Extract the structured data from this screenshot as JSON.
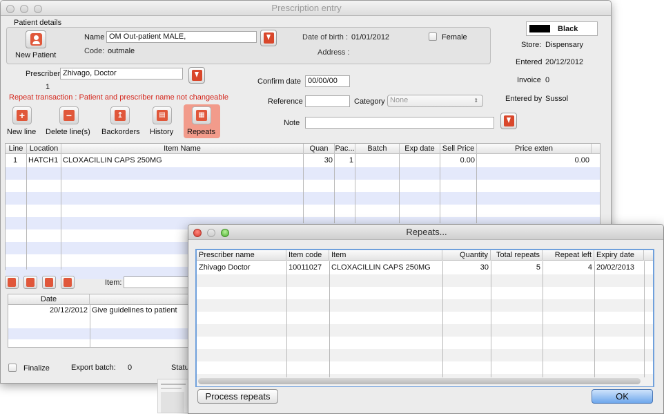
{
  "main_window": {
    "title": "Prescription entry",
    "patient_details": {
      "section_title": "Patient details",
      "new_patient_label": "New Patient",
      "name_label": "Name",
      "name_value": "OM Out-patient MALE,",
      "code_label": "Code:",
      "code_value": "outmale",
      "dob_label": "Date of birth :",
      "dob_value": "01/01/2012",
      "address_label": "Address :",
      "female_label": "Female"
    },
    "status_panel": {
      "color_label": "Black",
      "store_label": "Store:",
      "store_value": "Dispensary",
      "entered_label": "Entered",
      "entered_value": "20/12/2012",
      "invoice_label": "Invoice",
      "invoice_value": "0",
      "entered_by_label": "Entered by",
      "entered_by_value": "Sussol"
    },
    "prescriber_label": "Prescriber",
    "prescriber_value": "Zhivago, Doctor",
    "prescriber_count": "1",
    "warning_text": "Repeat transaction : Patient and prescriber  name not changeable",
    "confirm_date_label": "Confirm date",
    "confirm_date_value": "00/00/00",
    "reference_label": "Reference",
    "reference_value": "",
    "category_label": "Category",
    "category_value": "None",
    "note_label": "Note",
    "note_value": "",
    "toolbar": {
      "new_line": "New line",
      "delete_lines": "Delete line(s)",
      "backorders": "Backorders",
      "history": "History",
      "repeats": "Repeats"
    },
    "lines_table": {
      "headers": [
        "Line",
        "Location",
        "Item Name",
        "Quan",
        "Pac...",
        "Batch",
        "Exp date",
        "Sell Price",
        "Price exten"
      ],
      "rows": [
        {
          "line": "1",
          "location": "HATCH1",
          "item": "CLOXACILLIN CAPS 250MG",
          "quan": "30",
          "pack": "1",
          "batch": "",
          "exp": "",
          "sell": "0.00",
          "exten": "0.00"
        }
      ]
    },
    "item_label": "Item:",
    "history_table": {
      "header_date": "Date",
      "rows": [
        {
          "date": "20/12/2012",
          "text": "Give guidelines to patient"
        }
      ]
    },
    "finalize_label": "Finalize",
    "export_batch_label": "Export batch:",
    "export_batch_value": "0",
    "status_label_partial": "Statu"
  },
  "repeats_window": {
    "title": "Repeats...",
    "headers": [
      "Prescriber name",
      "Item code",
      "Item",
      "Quantity",
      "Total repeats",
      "Repeat left",
      "Expiry date"
    ],
    "rows": [
      {
        "prescriber": "Zhivago Doctor",
        "code": "10011027",
        "item": "CLOXACILLIN CAPS 250MG",
        "quantity": "30",
        "total": "5",
        "left": "4",
        "expiry": "20/02/2013"
      }
    ],
    "process_button": "Process repeats",
    "ok_button": "OK"
  },
  "colors": {
    "accent_red": "#e0573a",
    "warning_text": "#d4261c",
    "row_stripe": "#e4e9fb",
    "repeats_highlight": "#f29b8b"
  }
}
